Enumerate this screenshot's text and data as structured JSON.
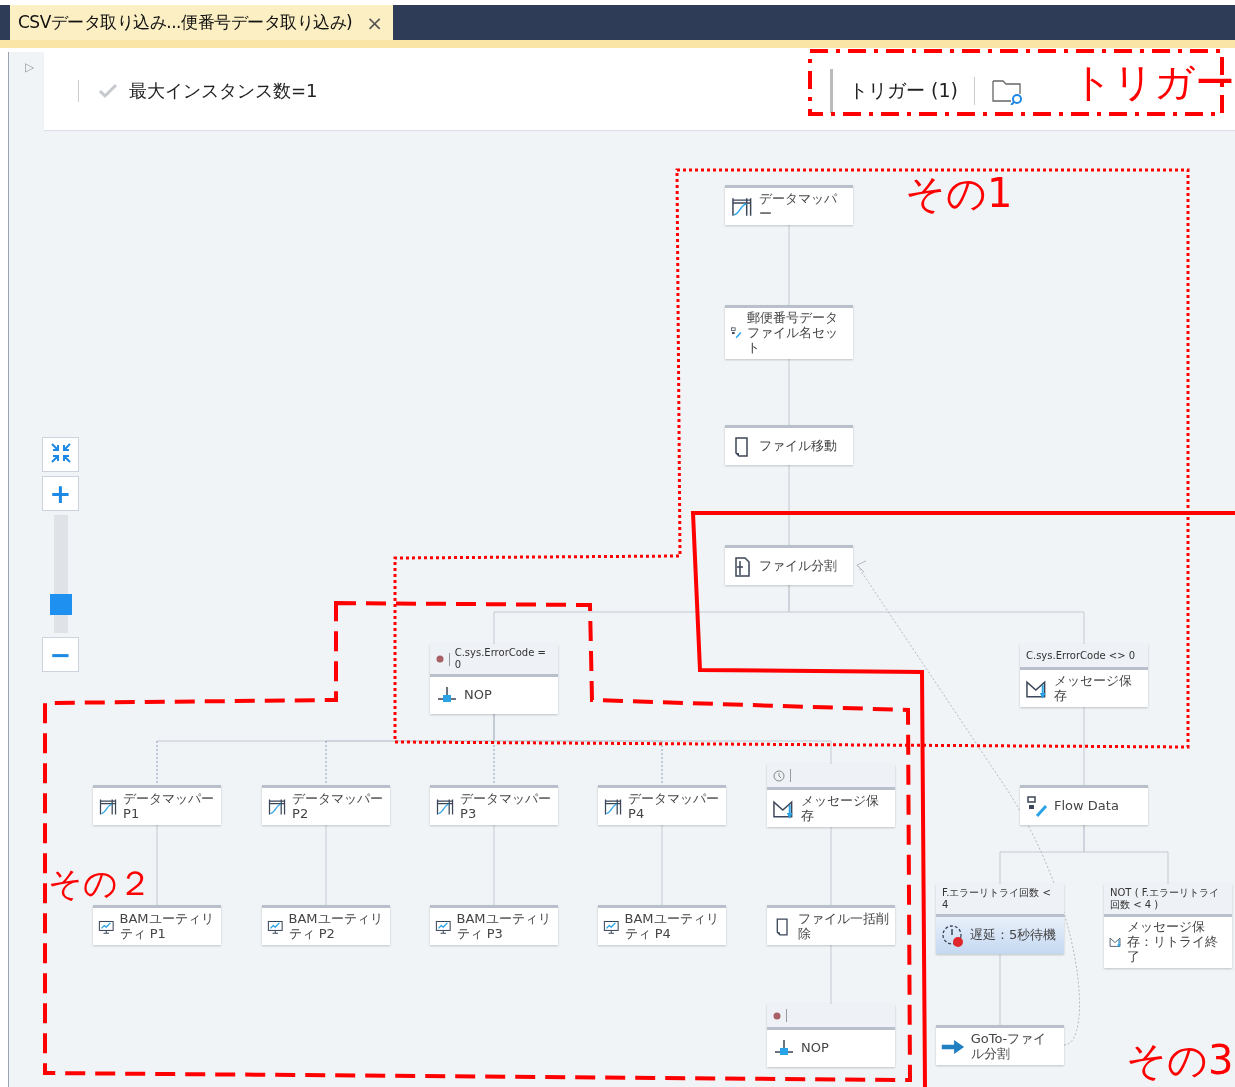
{
  "tab": {
    "title": "CSVデータ取り込み...便番号データ取り込み)",
    "close": "×"
  },
  "toolbar": {
    "expander": "▷",
    "max_instances": "最大インスタンス数=1",
    "trigger": "トリガー (1)"
  },
  "zoom": {
    "plus": "+",
    "minus": "−",
    "level": 0.24
  },
  "nodes": [
    {
      "kind": "mapper",
      "label": "データマッパー",
      "selected": false
    },
    {
      "kind": "edit",
      "label": "郵便番号データファイル名セット",
      "selected": false
    },
    {
      "kind": "file",
      "label": "ファイル移動",
      "selected": false
    },
    {
      "kind": "split",
      "label": "ファイル分割",
      "selected": false
    },
    {
      "kind": "nop",
      "label": "NOP",
      "condition": "C.sys.ErrorCode = 0",
      "selected": false
    },
    {
      "kind": "message",
      "label": "メッセージ保存",
      "condition": "C.sys.ErrorCode <> 0",
      "selected": false
    },
    {
      "kind": "mapper",
      "label": "データマッパー P1",
      "selected": false
    },
    {
      "kind": "mapper",
      "label": "データマッパー P2",
      "selected": false
    },
    {
      "kind": "mapper",
      "label": "データマッパー P3",
      "selected": false
    },
    {
      "kind": "mapper",
      "label": "データマッパー P4",
      "selected": false
    },
    {
      "kind": "message",
      "label": "メッセージ保存",
      "selected": false
    },
    {
      "kind": "edit",
      "label": "Flow Data",
      "selected": false
    },
    {
      "kind": "monitor",
      "label": "BAMユーティリティ P1",
      "selected": false
    },
    {
      "kind": "monitor",
      "label": "BAMユーティリティ P2",
      "selected": false
    },
    {
      "kind": "monitor",
      "label": "BAMユーティリティ P3",
      "selected": false
    },
    {
      "kind": "monitor",
      "label": "BAMユーティリティ P4",
      "selected": false
    },
    {
      "kind": "file",
      "label": "ファイル一括削除",
      "selected": false
    },
    {
      "kind": "wait",
      "label": "遅延：5秒待機",
      "condition": "F.エラーリトライ回数 < 4",
      "selected": true
    },
    {
      "kind": "message",
      "label": "メッセージ保存：リトライ終了",
      "condition": "NOT ( F.エラーリトライ回数 < 4 )",
      "selected": false
    },
    {
      "kind": "nop",
      "label": "NOP",
      "selected": false
    },
    {
      "kind": "goto",
      "label": "GoTo-ファイル分割",
      "selected": false
    }
  ],
  "annotations": [
    {
      "label": "トリガー"
    },
    {
      "label": "その1"
    },
    {
      "label": "その２"
    },
    {
      "label": "その3"
    }
  ]
}
